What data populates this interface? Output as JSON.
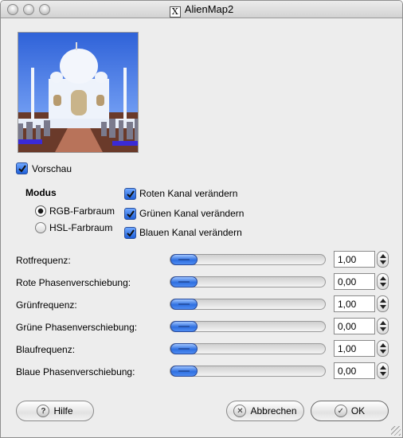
{
  "window": {
    "title": "AlienMap2",
    "title_icon": "x11-icon"
  },
  "preview": {
    "checkbox_label": "Vorschau",
    "checked": true
  },
  "mode": {
    "heading": "Modus",
    "options": [
      {
        "label": "RGB-Farbraum",
        "selected": true
      },
      {
        "label": "HSL-Farbraum",
        "selected": false
      }
    ]
  },
  "channels": [
    {
      "label": "Roten Kanal verändern",
      "checked": true
    },
    {
      "label": "Grünen Kanal verändern",
      "checked": true
    },
    {
      "label": "Blauen Kanal verändern",
      "checked": true
    }
  ],
  "sliders": [
    {
      "label": "Rotfrequenz:",
      "value": "1,00",
      "level": 0.0
    },
    {
      "label": "Rote Phasenverschiebung:",
      "value": "0,00",
      "level": 0.0
    },
    {
      "label": "Grünfrequenz:",
      "value": "1,00",
      "level": 0.0
    },
    {
      "label": "Grüne Phasenverschiebung:",
      "value": "0,00",
      "level": 0.0
    },
    {
      "label": "Blaufrequenz:",
      "value": "1,00",
      "level": 0.0
    },
    {
      "label": "Blaue Phasenverschiebung:",
      "value": "0,00",
      "level": 0.0
    }
  ],
  "buttons": {
    "help": {
      "label": "Hilfe",
      "icon": "question-icon"
    },
    "cancel": {
      "label": "Abbrechen",
      "icon": "cancel-icon"
    },
    "ok": {
      "label": "OK",
      "icon": "checkmark-icon"
    }
  }
}
